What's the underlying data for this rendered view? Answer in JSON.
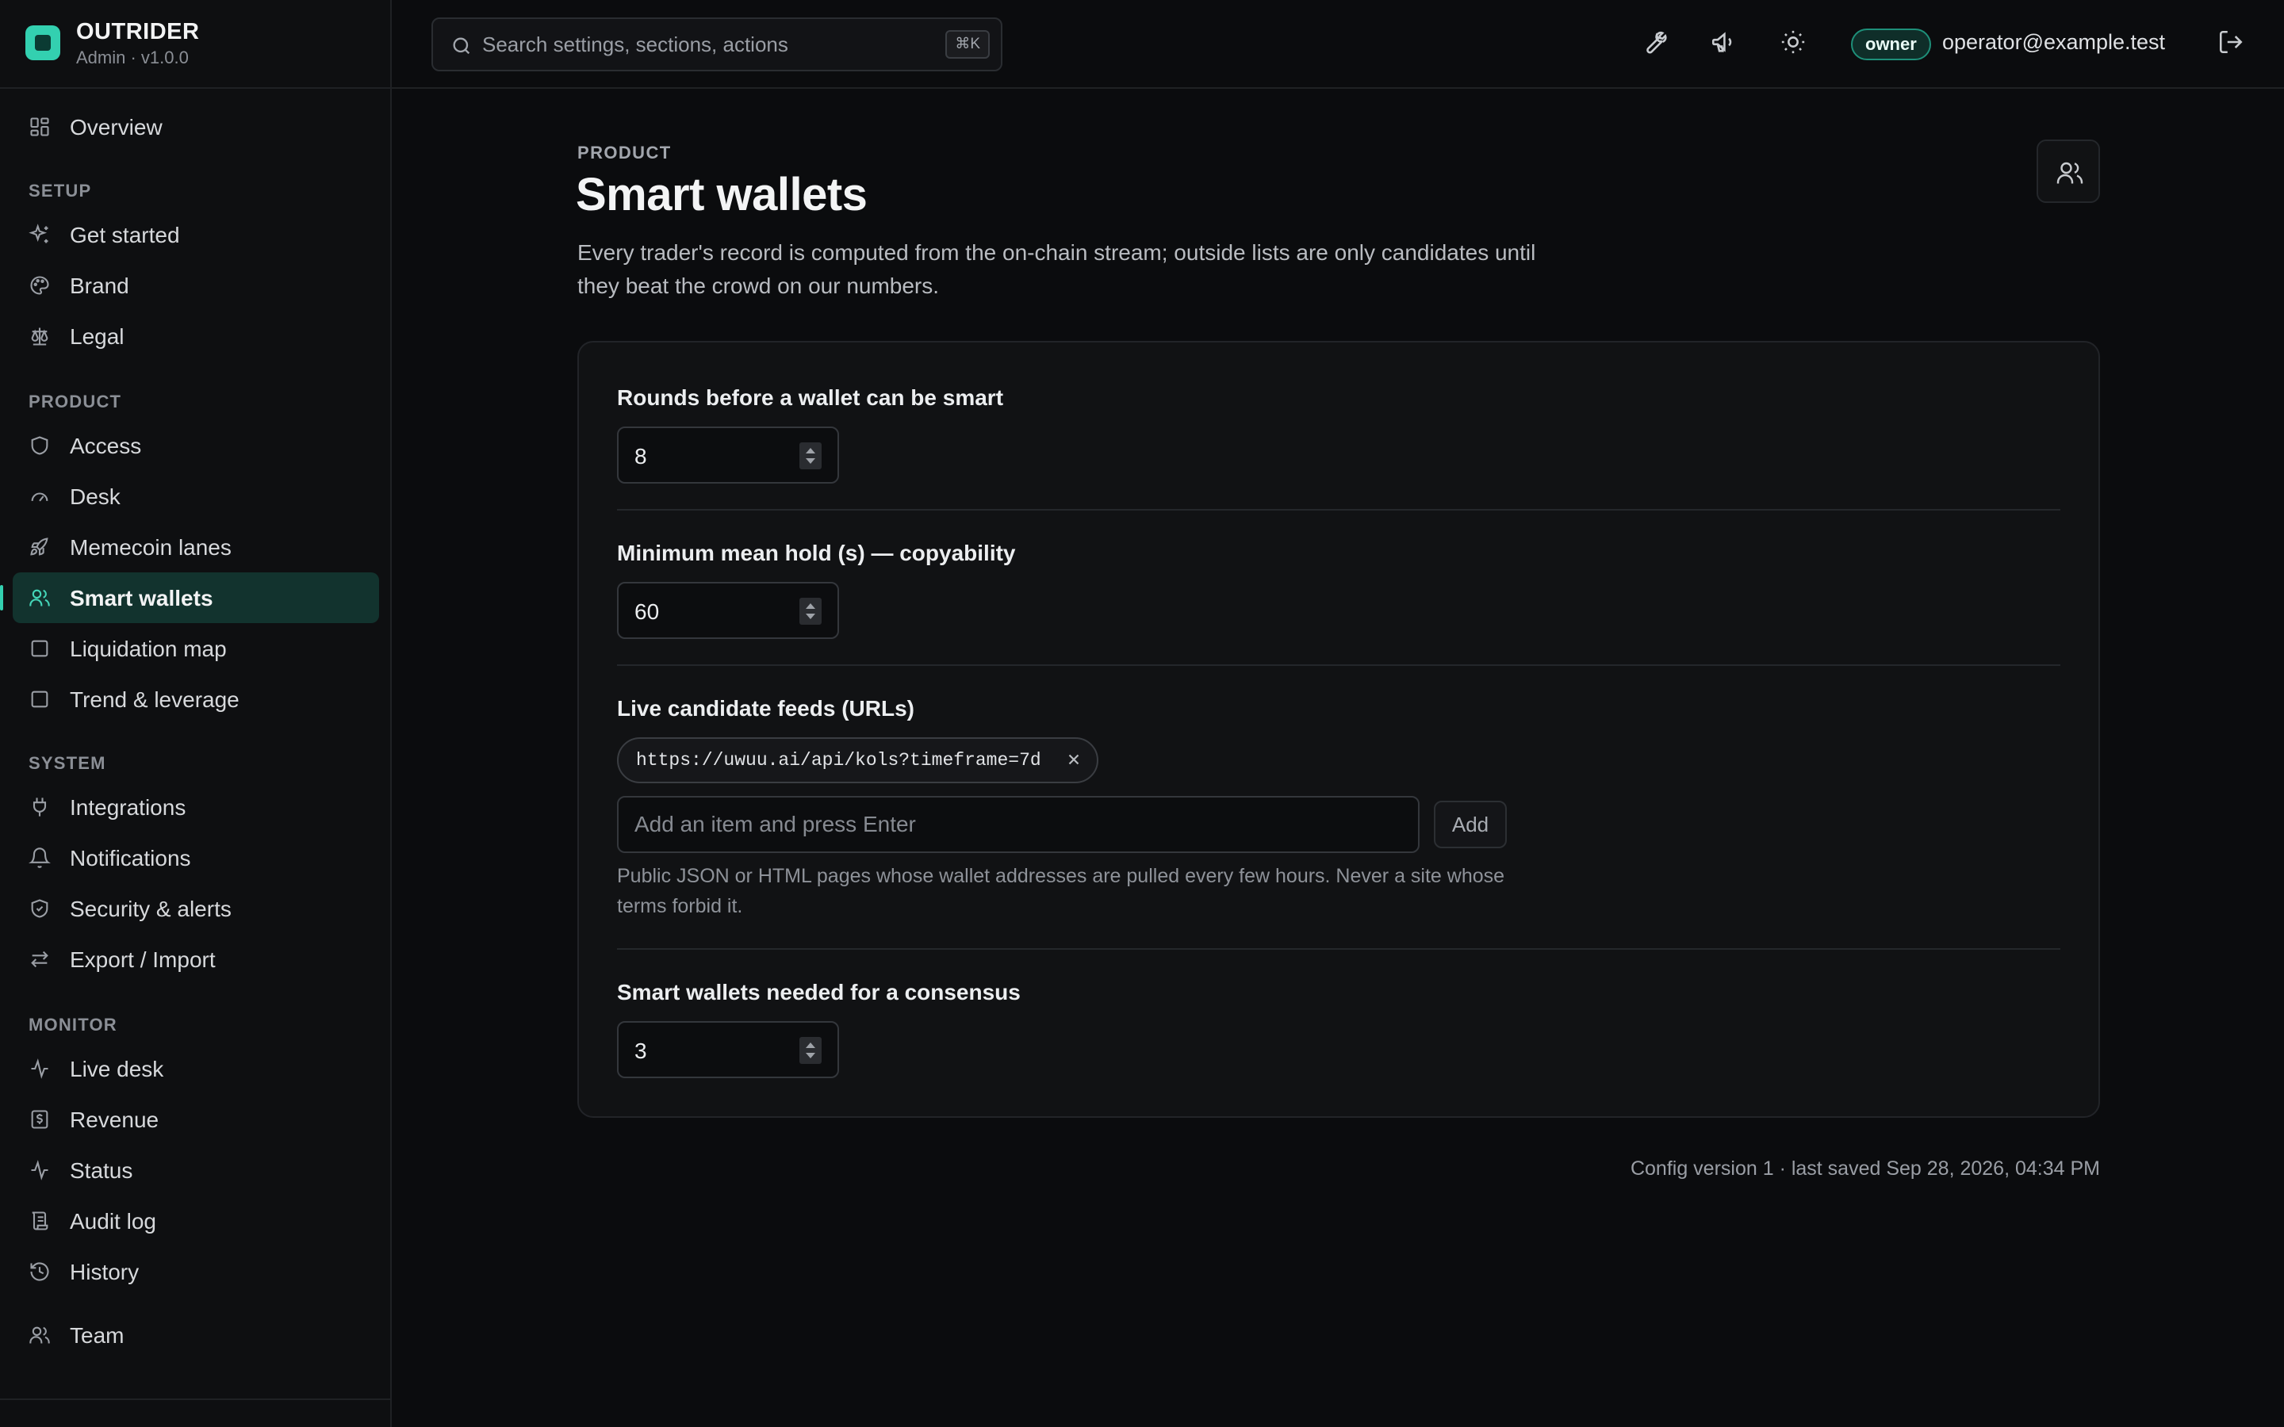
{
  "app": {
    "name": "OUTRIDER",
    "subtitle": "Admin · v1.0.0"
  },
  "search": {
    "placeholder": "Search settings, sections, actions",
    "shortcut": "⌘K"
  },
  "topbar": {
    "icons": [
      "wrench-icon",
      "megaphone-icon",
      "sun-icon"
    ],
    "role": "owner",
    "email": "operator@example.test",
    "logout_icon": "logout-icon"
  },
  "sidebar": {
    "overview": "Overview",
    "sections": {
      "setup": "SETUP",
      "product": "PRODUCT",
      "system": "SYSTEM",
      "monitor": "MONITOR"
    },
    "setup_items": [
      "Get started",
      "Brand",
      "Legal"
    ],
    "product_items": [
      "Access",
      "Desk",
      "Memecoin lanes",
      "Smart wallets",
      "Liquidation map",
      "Trend & leverage"
    ],
    "system_items": [
      "Integrations",
      "Notifications",
      "Security & alerts",
      "Export / Import"
    ],
    "monitor_items": [
      "Live desk",
      "Revenue",
      "Status",
      "Audit log",
      "History"
    ],
    "team": "Team",
    "active": "Smart wallets",
    "accent_color": "#33d0b0"
  },
  "page": {
    "breadcrumb": "PRODUCT",
    "title": "Smart wallets",
    "description": "Every trader's record is computed from the on-chain stream; outside lists are only candidates until they beat the crowd on our numbers."
  },
  "form": {
    "rounds": {
      "label": "Rounds before a wallet can be smart",
      "value": "8"
    },
    "min_hold": {
      "label": "Minimum mean hold (s) — copyability",
      "value": "60"
    },
    "feeds": {
      "label": "Live candidate feeds (URLs)",
      "items": [
        "https://uwuu.ai/api/kols?timeframe=7d"
      ],
      "input_placeholder": "Add an item and press Enter",
      "add_label": "Add",
      "help": "Public JSON or HTML pages whose wallet addresses are pulled every few hours. Never a site whose terms forbid it."
    },
    "consensus": {
      "label": "Smart wallets needed for a consensus",
      "value": "3"
    }
  },
  "footer": {
    "config_status": "Config version 1 · last saved Sep 28, 2026, 04:34 PM"
  }
}
